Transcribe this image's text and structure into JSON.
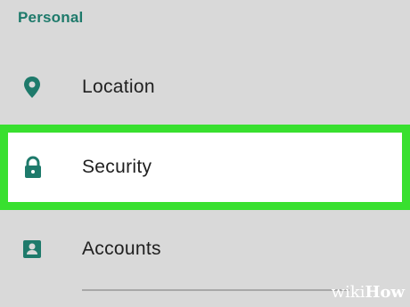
{
  "section": {
    "title": "Personal"
  },
  "items": [
    {
      "label": "Location",
      "icon": "location-pin-icon"
    },
    {
      "label": "Security",
      "icon": "lock-icon"
    },
    {
      "label": "Accounts",
      "icon": "account-icon"
    }
  ],
  "colors": {
    "accent": "#1e7a6b",
    "highlight": "#38e02f",
    "background": "#d9d9d9"
  },
  "watermark": {
    "wiki": "wiki",
    "how": "How"
  }
}
